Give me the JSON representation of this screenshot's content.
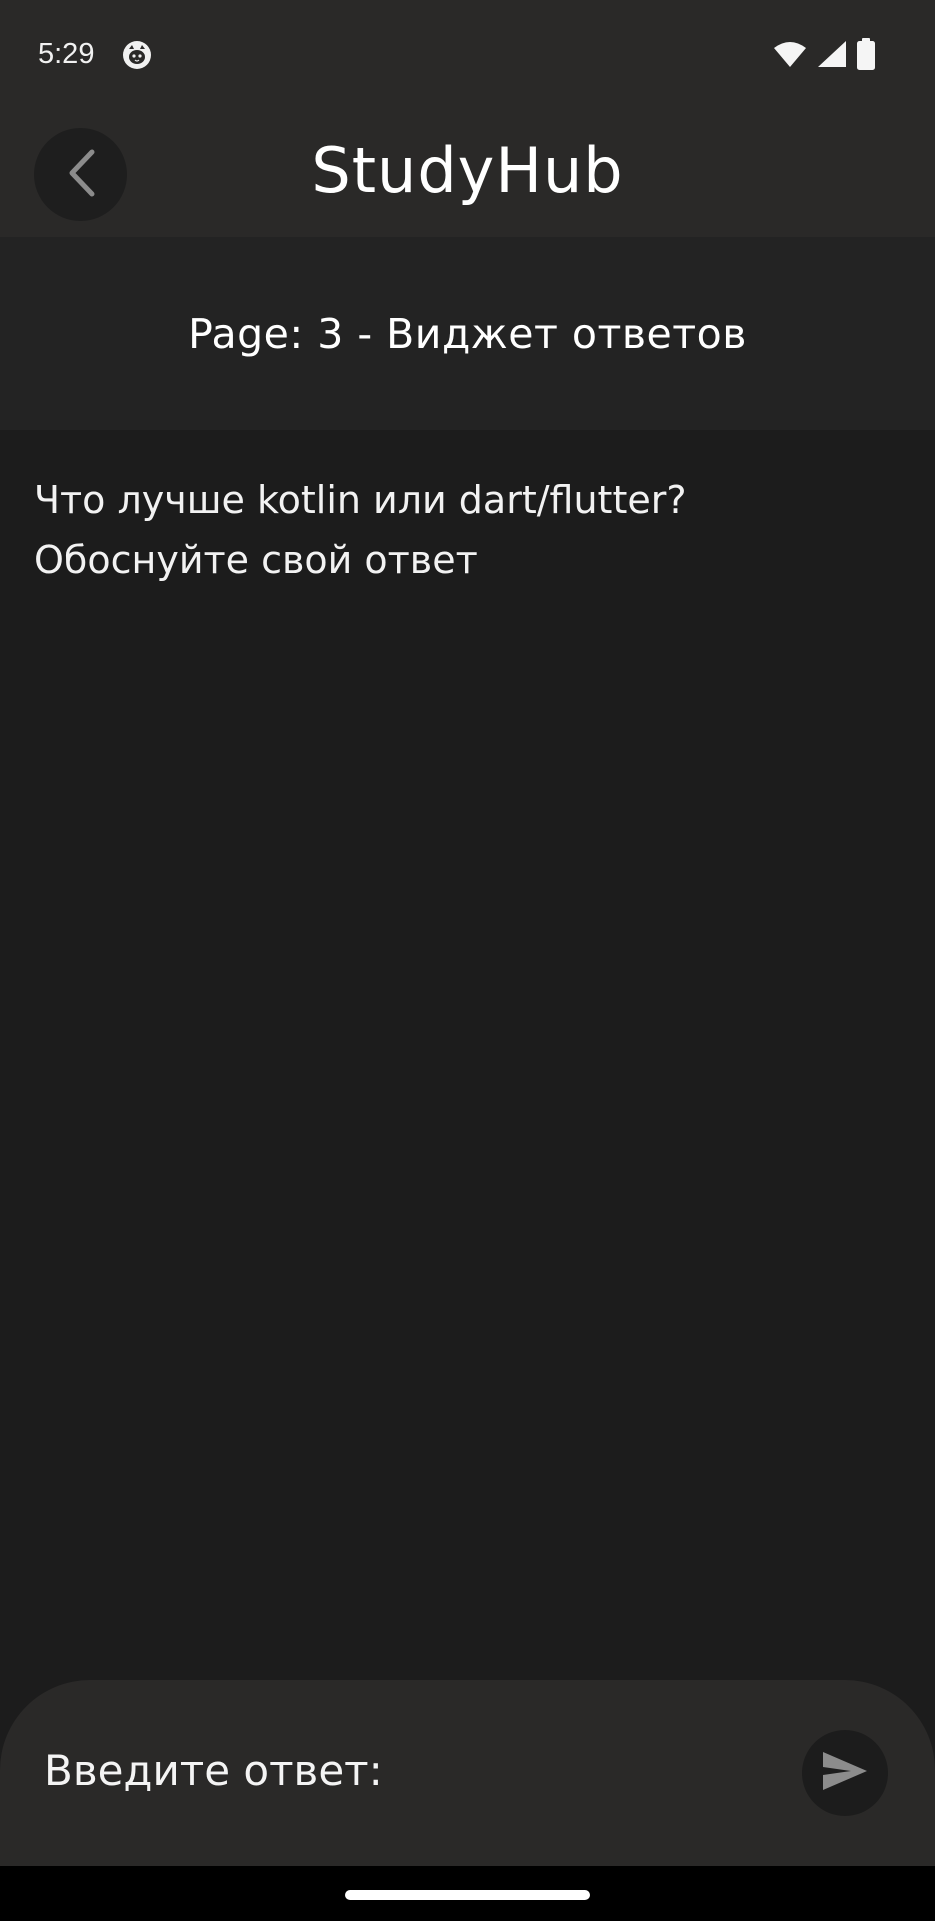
{
  "status_bar": {
    "time": "5:29",
    "icons": [
      "cat-face-icon",
      "wifi-icon",
      "signal-icon",
      "battery-icon"
    ]
  },
  "app_bar": {
    "title": "StudyHub",
    "back_icon": "chevron-left-icon"
  },
  "page_header": {
    "text": "Page: 3 - Виджет ответов"
  },
  "question": {
    "line1": "Что лучше kotlin или dart/flutter?",
    "line2": "Обоснуйте свой ответ"
  },
  "composer": {
    "placeholder": "Введите ответ:",
    "value": "",
    "send_icon": "send-icon"
  },
  "colors": {
    "background": "#1c1c1c",
    "bar": "#2a2928",
    "header": "#232323",
    "text": "#ffffff",
    "icon_muted": "#8c8c8c"
  }
}
